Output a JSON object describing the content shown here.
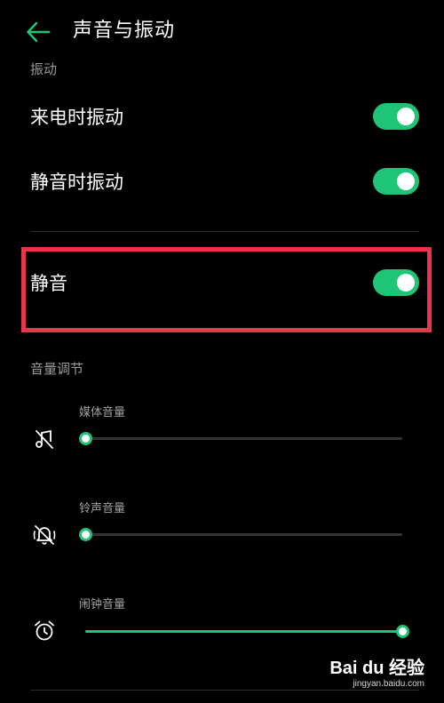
{
  "header": {
    "back_icon": "arrow-left-icon",
    "title": "声音与振动"
  },
  "accent_color": "#1fc477",
  "highlight_color": "#e8354a",
  "vibration": {
    "section_label": "振动",
    "items": [
      {
        "label": "来电时振动",
        "checked": true
      },
      {
        "label": "静音时振动",
        "checked": true
      }
    ]
  },
  "silent": {
    "label": "静音",
    "checked": true
  },
  "volume": {
    "section_label": "音量调节",
    "items": [
      {
        "label": "媒体音量",
        "icon": "music-note-muted-icon",
        "level": 0
      },
      {
        "label": "铃声音量",
        "icon": "bell-muted-icon",
        "level": 0
      },
      {
        "label": "闹钟音量",
        "icon": "alarm-clock-icon",
        "level": 1
      }
    ]
  },
  "watermark": {
    "text": "Bai du 经验",
    "url": "jingyan.baidu.com"
  }
}
